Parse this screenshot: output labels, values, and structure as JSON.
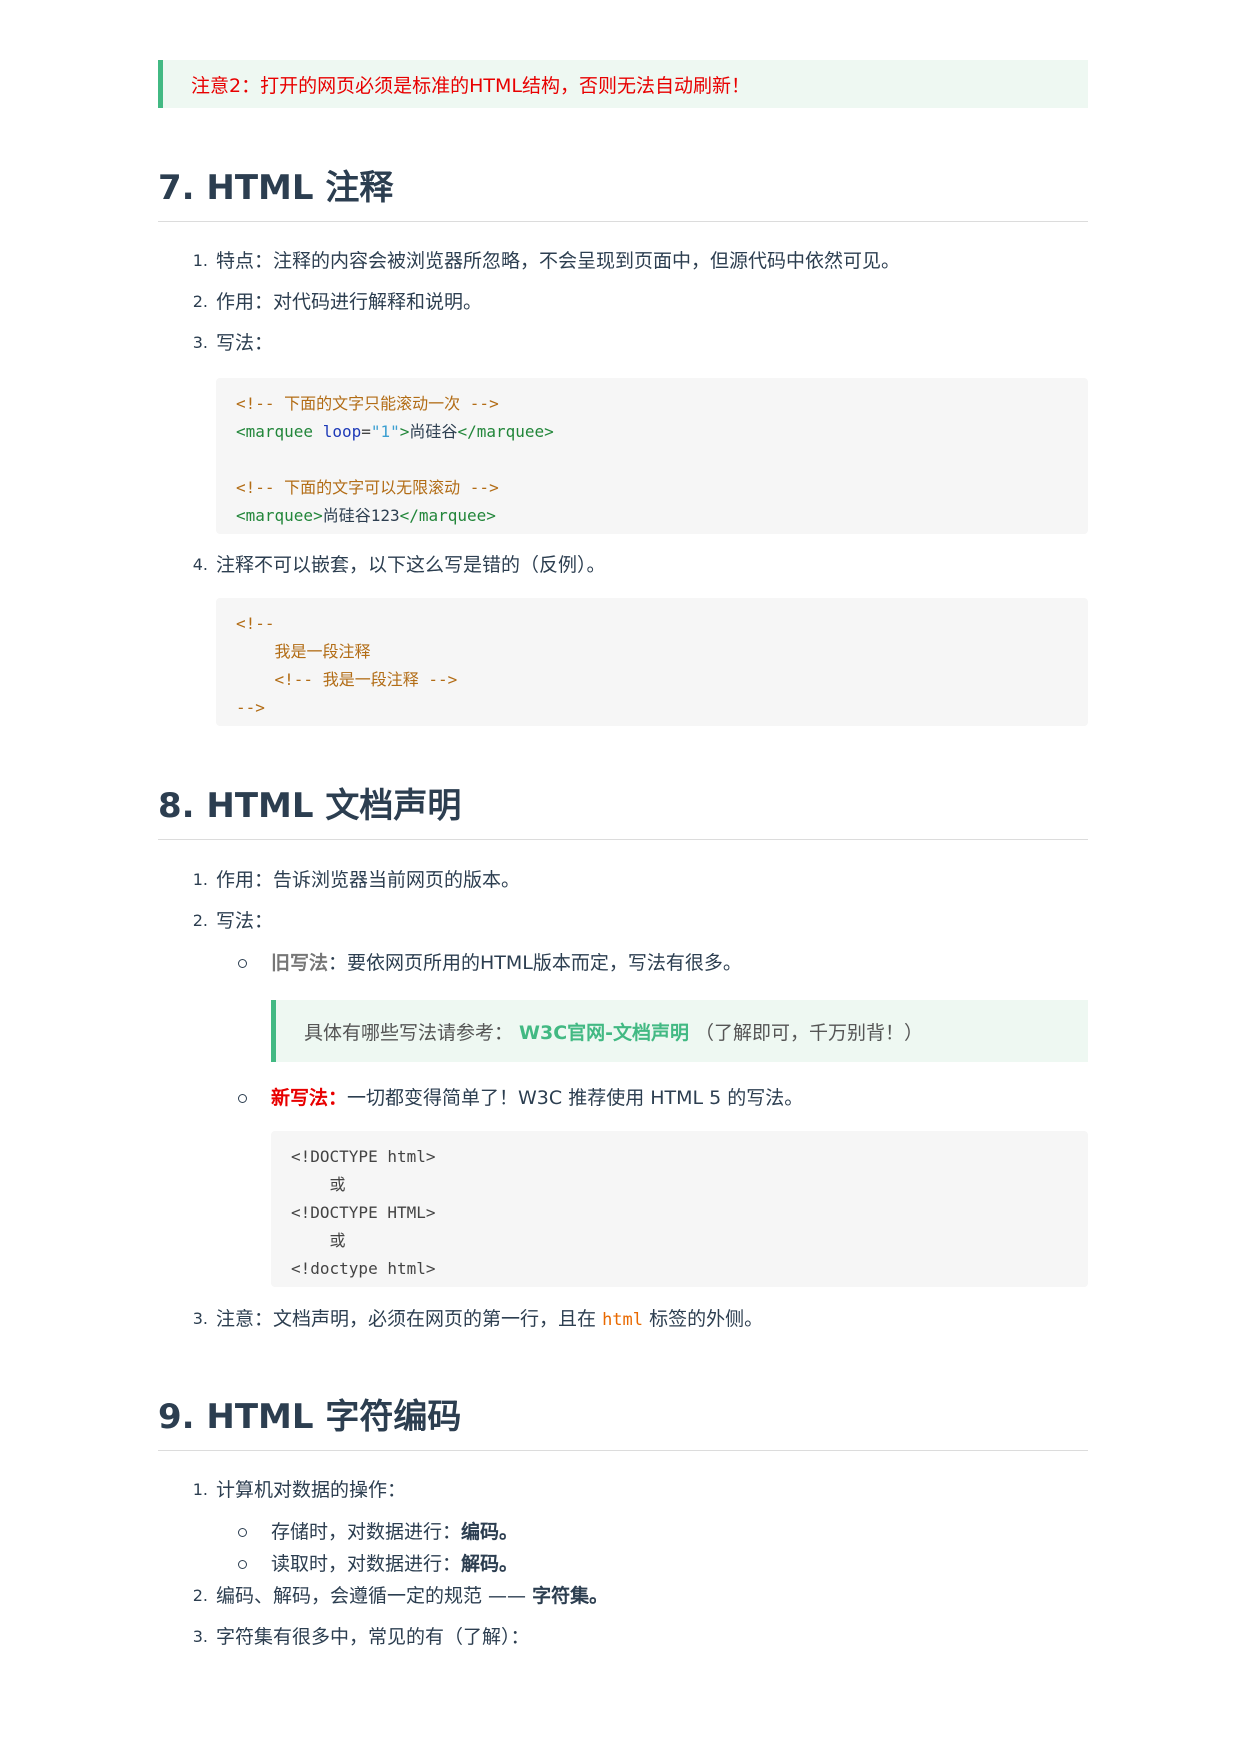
{
  "note2": "注意2：打开的网页必须是标准的HTML结构，否则无法自动刷新！",
  "sec7": {
    "title": "7. HTML 注释",
    "items": [
      {
        "num": "1.",
        "text": "特点：注释的内容会被浏览器所忽略，不会呈现到页面中，但源代码中依然可见。"
      },
      {
        "num": "2.",
        "text": "作用：对代码进行解释和说明。"
      },
      {
        "num": "3.",
        "text": "写法："
      },
      {
        "num": "4.",
        "text": "注释不可以嵌套，以下这么写是错的（反例）。"
      }
    ],
    "code1": {
      "c1": "<!-- 下面的文字只能滚动一次 -->",
      "l2_tag_open": "<marquee",
      "l2_attr": "loop",
      "l2_eq": "=",
      "l2_val": "\"1\"",
      "l2_close": ">",
      "l2_text": "尚硅谷",
      "l2_end": "</marquee>",
      "c3": "<!-- 下面的文字可以无限滚动 -->",
      "l4_open": "<marquee>",
      "l4_text": "尚硅谷123",
      "l4_end": "</marquee>"
    },
    "code2": {
      "l1": "<!--",
      "l2": "    我是一段注释",
      "l3": "    <!-- 我是一段注释 -->",
      "l4": "-->"
    }
  },
  "sec8": {
    "title": "8. HTML 文档声明",
    "item1": {
      "num": "1.",
      "text": "作用：告诉浏览器当前网页的版本。"
    },
    "item2": {
      "num": "2.",
      "text": "写法："
    },
    "old": {
      "label": "旧写法",
      "text": "：要依网页所用的HTML版本而定，写法有很多。"
    },
    "quote": {
      "prefix": "具体有哪些写法请参考：",
      "link": "W3C官网-文档声明",
      "suffix": "（了解即可，千万别背！）"
    },
    "new": {
      "label": "新写法：",
      "text": "一切都变得简单了！W3C 推荐使用 HTML 5 的写法。"
    },
    "code": {
      "l1": "<!DOCTYPE html>",
      "l2": "    或",
      "l3": "<!DOCTYPE HTML>",
      "l4": "    或",
      "l5": "<!doctype html>"
    },
    "item3": {
      "num": "3.",
      "before": "注意：文档声明，必须在网页的第一行，且在",
      "code": "html",
      "after": "标签的外侧。"
    }
  },
  "sec9": {
    "title": "9. HTML 字符编码",
    "item1": {
      "num": "1.",
      "text": "计算机对数据的操作："
    },
    "sub1": {
      "text": "存储时，对数据进行：",
      "bold": "编码。"
    },
    "sub2": {
      "text": "读取时，对数据进行：",
      "bold": "解码。"
    },
    "item2": {
      "num": "2.",
      "text": "编码、解码，会遵循一定的规范 —— ",
      "bold": "字符集。"
    },
    "item3": {
      "num": "3.",
      "text": "字符集有很多中，常见的有（了解）："
    }
  }
}
